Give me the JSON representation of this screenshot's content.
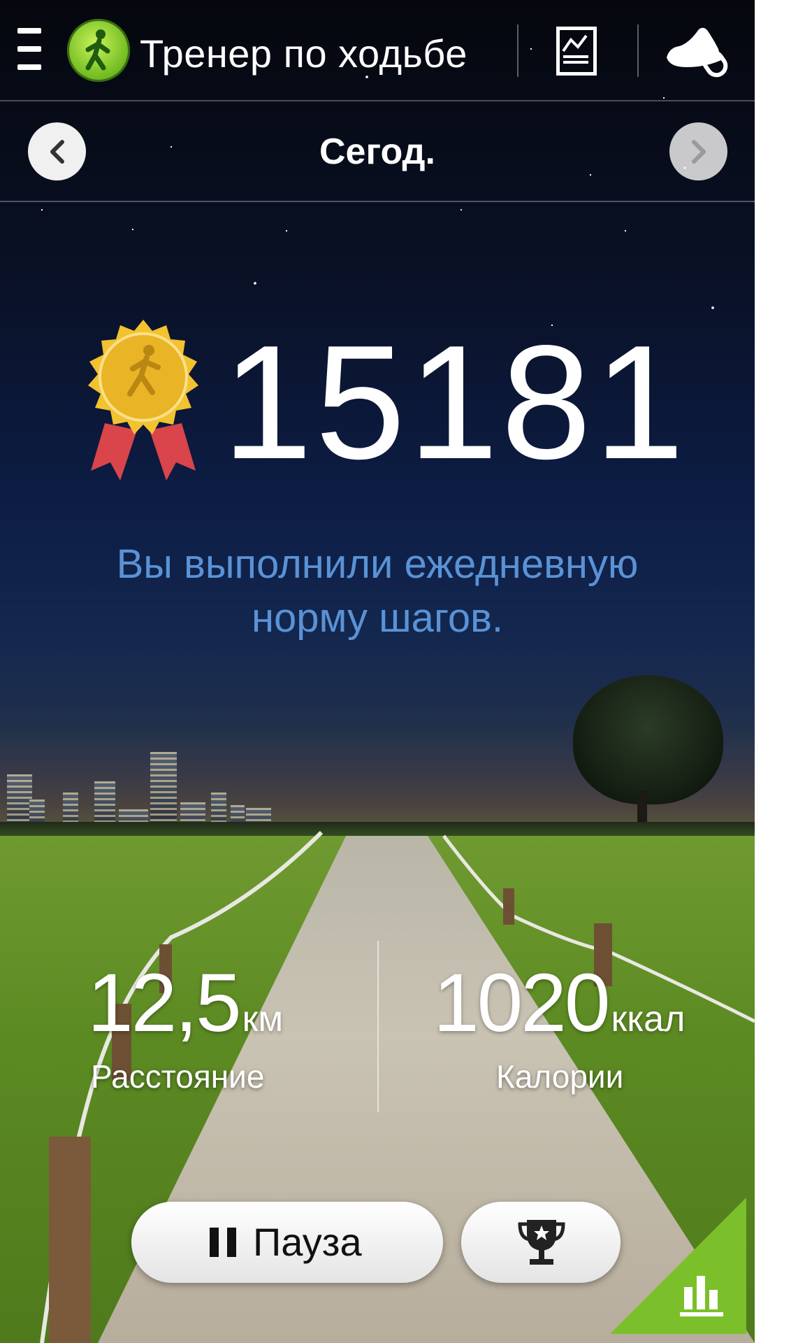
{
  "app": {
    "title": "Тренер по ходьбе"
  },
  "date_nav": {
    "label": "Сегод."
  },
  "steps": {
    "count": "15181"
  },
  "message": {
    "line1": "Вы выполнили ежедневную",
    "line2": "норму шагов."
  },
  "stats": {
    "distance": {
      "value": "12,5",
      "unit": "км",
      "label": "Расстояние"
    },
    "calories": {
      "value": "1020",
      "unit": "ккал",
      "label": "Калории"
    }
  },
  "buttons": {
    "pause_label": "Пауза"
  },
  "colors": {
    "message": "#5a92d6",
    "accent_green": "#7bbf2a",
    "medal_gold": "#f2c230",
    "ribbon": "#d9454b"
  },
  "icons": {
    "menu": "menu-icon",
    "logo": "walking-person-icon",
    "chart": "chart-icon",
    "shoe": "shoe-icon",
    "prev": "chevron-left-icon",
    "next": "chevron-right-icon",
    "medal": "medal-icon",
    "pause": "pause-icon",
    "trophy": "trophy-icon",
    "stats": "bar-chart-icon"
  }
}
